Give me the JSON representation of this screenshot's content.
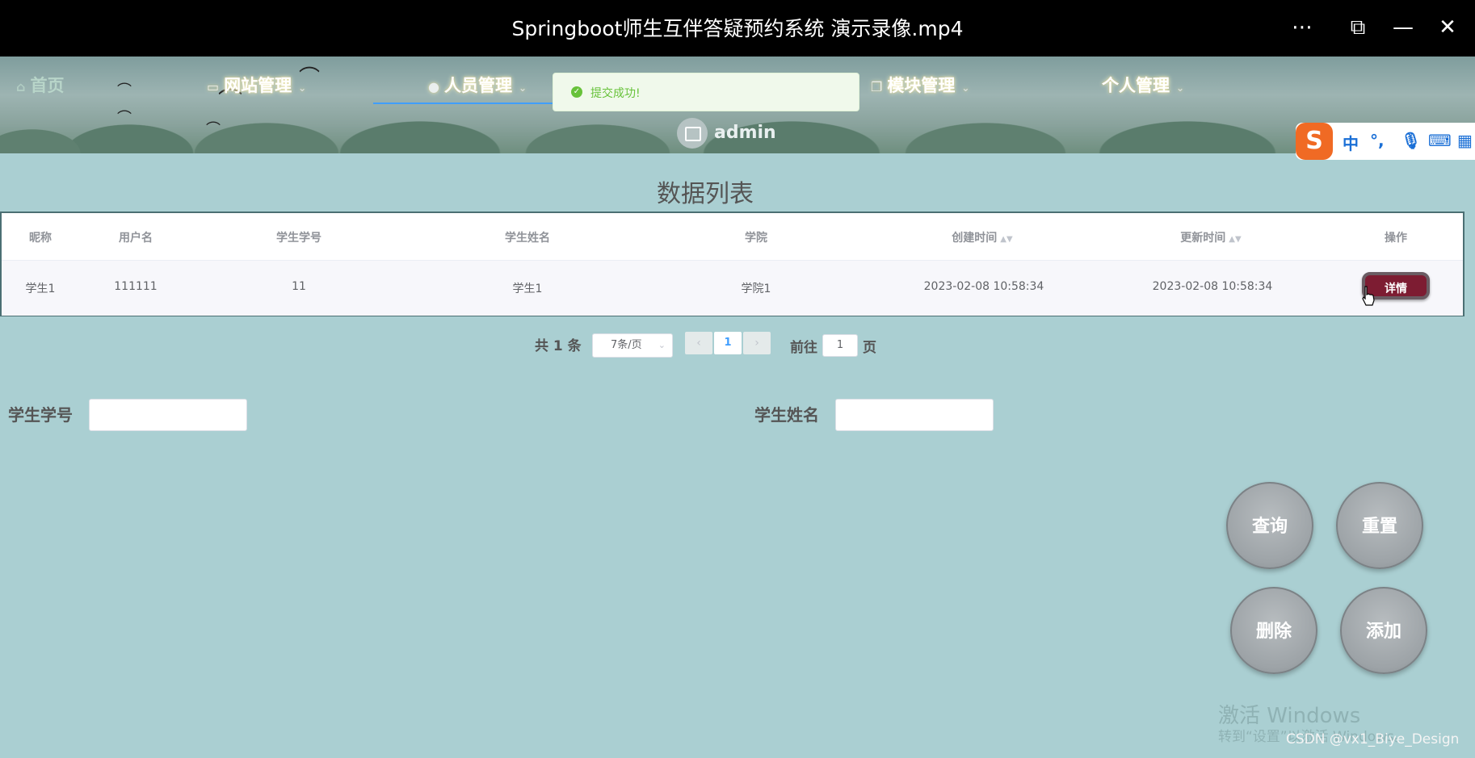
{
  "player": {
    "title": "Springboot师生互伴答疑预约系统 演示录像.mp4",
    "controls": [
      "more-icon",
      "pip-icon",
      "minimize-icon",
      "close-icon"
    ]
  },
  "nav": {
    "home": "首页",
    "site_admin": "网站管理",
    "people_admin": "人员管理",
    "module_admin": "模块管理",
    "personal_admin": "个人管理",
    "user": "admin"
  },
  "toast": {
    "message": "提交成功!"
  },
  "ime": {
    "logo": "S",
    "symbols": [
      "中",
      "°,",
      "mic-icon",
      "keyboard-icon",
      "grid-icon"
    ]
  },
  "table": {
    "title": "数据列表",
    "headers": [
      "昵称",
      "用户名",
      "学生学号",
      "学生姓名",
      "学院",
      "创建时间",
      "更新时间",
      "操作"
    ],
    "rows": [
      {
        "nickname": "学生1",
        "username": "111111",
        "student_no": "11",
        "student_name": "学生1",
        "college": "学院1",
        "created": "2023-02-08 10:58:34",
        "updated": "2023-02-08 10:58:34",
        "action": "详情"
      }
    ]
  },
  "pagination": {
    "total": "共 1 条",
    "page_size": "7条/页",
    "current_page": "1",
    "goto_label": "前往",
    "goto_value": "1",
    "page_suffix": "页"
  },
  "search": {
    "student_no_label": "学生学号",
    "student_name_label": "学生姓名",
    "query_btn": "查询",
    "reset_btn": "重置",
    "delete_btn": "删除",
    "add_btn": "添加"
  },
  "watermark": {
    "activate_title": "激活 Windows",
    "activate_sub": "转到“设置”以激活 Windows。",
    "csdn": "CSDN @vx1_Biye_Design"
  },
  "colors": {
    "background": "#aacfd2",
    "detail_button": "#7d1c32",
    "success": "#67c23a",
    "active_tab": "#409eff"
  }
}
